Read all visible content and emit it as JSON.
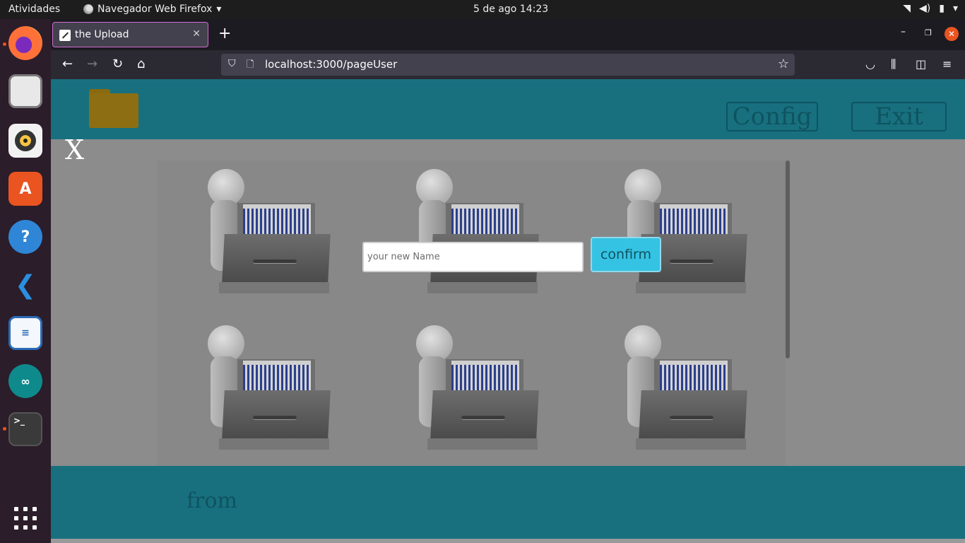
{
  "topbar": {
    "activities": "Atividades",
    "app_name": "Navegador Web Firefox",
    "clock": "5 de ago  14:23"
  },
  "dock": {
    "items": [
      "firefox-icon",
      "files-icon",
      "rhythmbox-icon",
      "software-icon",
      "help-icon",
      "vscode-icon",
      "writer-icon",
      "arduino-icon",
      "terminal-icon",
      "apps-grid-icon"
    ]
  },
  "browser": {
    "tab_title": "the Upload",
    "url": "localhost:3000/pageUser"
  },
  "page": {
    "header": {
      "config_label": "Config",
      "exit_label": "Exit"
    },
    "close_label": "X",
    "form": {
      "name_placeholder": "your new Name",
      "confirm_label": "confirm"
    },
    "footer": {
      "from_label": "from"
    }
  },
  "colors": {
    "header_bg": "#18707f",
    "accent_button": "#35c3e4",
    "overlay_gray": "#8c8c8c"
  }
}
